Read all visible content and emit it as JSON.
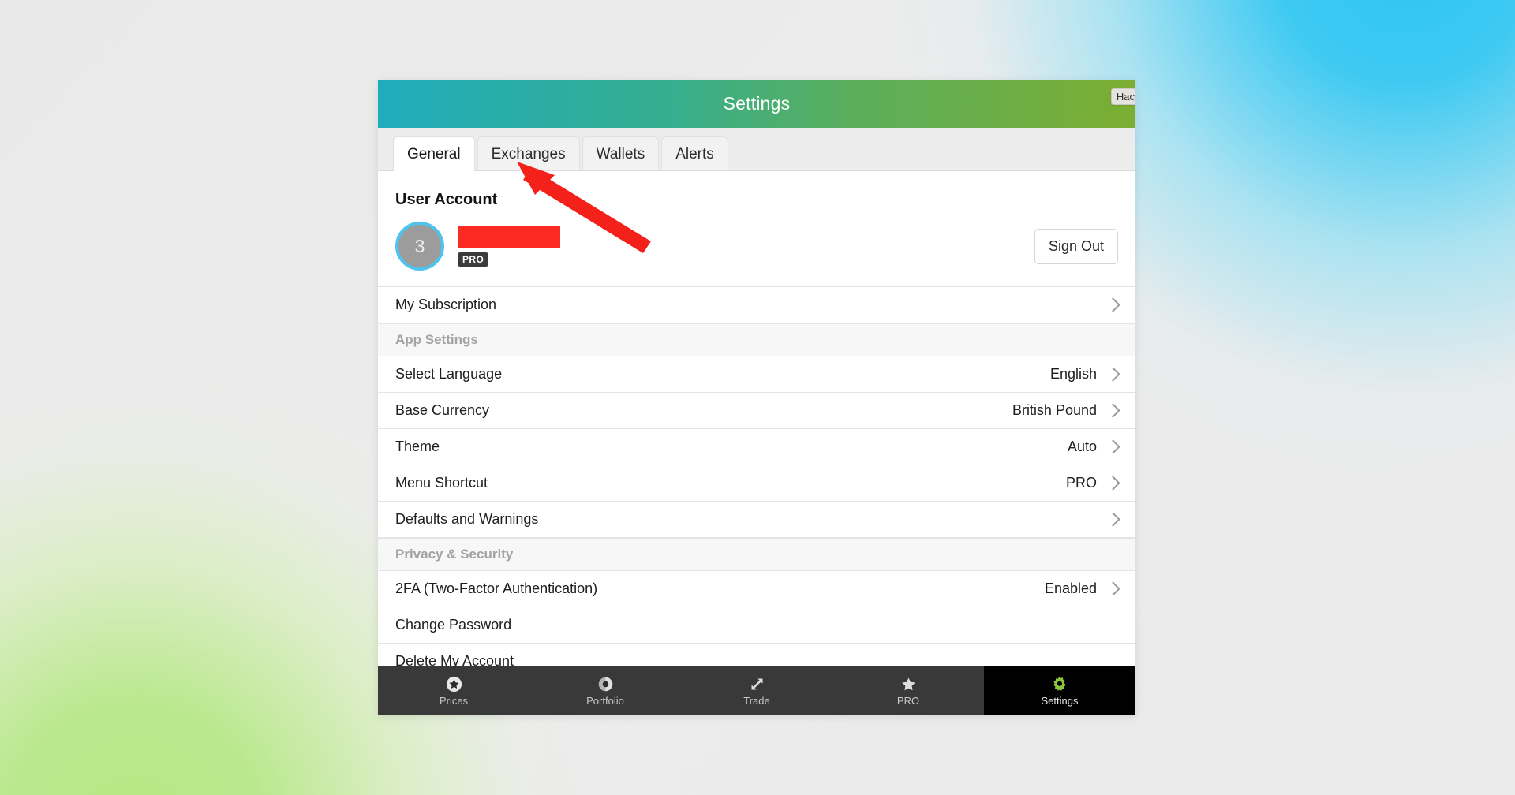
{
  "window": {
    "title": "Settings",
    "corner_chip_label": "Hac"
  },
  "tabs": [
    {
      "label": "General",
      "active": true,
      "name": "tab-general"
    },
    {
      "label": "Exchanges",
      "active": false,
      "name": "tab-exchanges"
    },
    {
      "label": "Wallets",
      "active": false,
      "name": "tab-wallets"
    },
    {
      "label": "Alerts",
      "active": false,
      "name": "tab-alerts"
    }
  ],
  "account": {
    "section_title": "User Account",
    "avatar_initial": "3",
    "avatar_ring_color": "#4ec3ed",
    "avatar_fill_color": "#9c9c9c",
    "name_redacted": true,
    "redaction_color": "#fc2a23",
    "badge_label": "PRO",
    "sign_out_label": "Sign Out"
  },
  "rows": {
    "subscription": {
      "label": "My Subscription",
      "value": ""
    },
    "app_settings_header": "App Settings",
    "language": {
      "label": "Select Language",
      "value": "English"
    },
    "currency": {
      "label": "Base Currency",
      "value": "British Pound"
    },
    "theme": {
      "label": "Theme",
      "value": "Auto"
    },
    "shortcut": {
      "label": "Menu Shortcut",
      "value": "PRO"
    },
    "defaults": {
      "label": "Defaults and Warnings",
      "value": ""
    },
    "privacy_header": "Privacy & Security",
    "twofa": {
      "label": "2FA (Two-Factor Authentication)",
      "value": "Enabled"
    },
    "password": {
      "label": "Change Password",
      "value": ""
    },
    "delete": {
      "label": "Delete My Account",
      "value": ""
    }
  },
  "bottom_nav": [
    {
      "label": "Prices",
      "icon": "star-circle-icon",
      "active": false
    },
    {
      "label": "Portfolio",
      "icon": "donut-chart-icon",
      "active": false
    },
    {
      "label": "Trade",
      "icon": "trade-arrows-icon",
      "active": false
    },
    {
      "label": "PRO",
      "icon": "star-icon",
      "active": false
    },
    {
      "label": "Settings",
      "icon": "gear-icon",
      "active": true
    }
  ],
  "colors": {
    "header_gradient_start": "#1facbd",
    "header_gradient_end": "#7cae31",
    "accent_green": "#8cc63f",
    "annotation_red": "#f32119"
  }
}
